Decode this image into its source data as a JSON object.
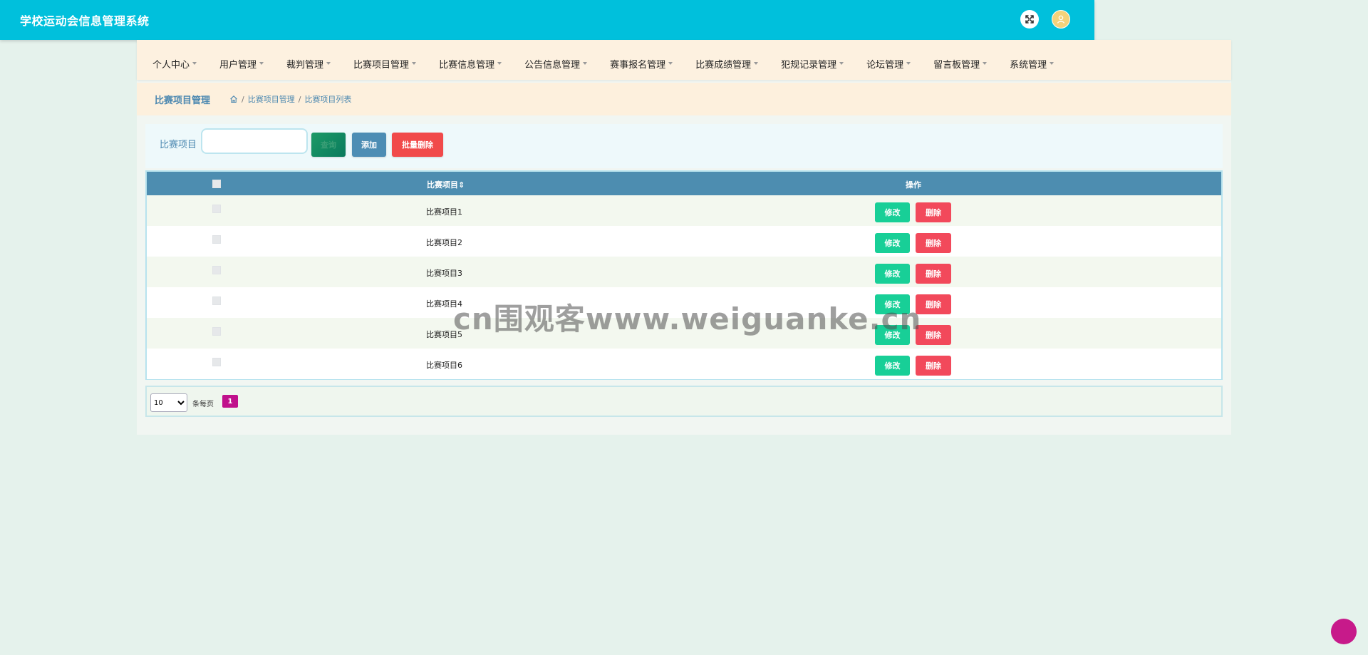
{
  "app": {
    "title": "学校运动会信息管理系统"
  },
  "header": {
    "fullscreen_icon": "fullscreen-toggle-icon",
    "avatar_icon": "user-avatar-icon"
  },
  "nav": {
    "items": [
      {
        "label": "个人中心"
      },
      {
        "label": "用户管理"
      },
      {
        "label": "裁判管理"
      },
      {
        "label": "比赛项目管理"
      },
      {
        "label": "比赛信息管理"
      },
      {
        "label": "公告信息管理"
      },
      {
        "label": "赛事报名管理"
      },
      {
        "label": "比赛成绩管理"
      },
      {
        "label": "犯规记录管理"
      },
      {
        "label": "论坛管理"
      },
      {
        "label": "留言板管理"
      },
      {
        "label": "系统管理"
      }
    ]
  },
  "breadcrumb": {
    "title": "比赛项目管理",
    "separator": "/",
    "path": [
      "比赛项目管理",
      "比赛项目列表"
    ]
  },
  "search": {
    "label": "比赛项目",
    "value": "",
    "placeholder": "",
    "query_label": "查询",
    "add_label": "添加",
    "batch_delete_label": "批量删除"
  },
  "table": {
    "headers": {
      "name": "比赛项目",
      "actions": "操作"
    },
    "rows": [
      {
        "name": "比赛项目1"
      },
      {
        "name": "比赛项目2"
      },
      {
        "name": "比赛项目3"
      },
      {
        "name": "比赛项目4"
      },
      {
        "name": "比赛项目5"
      },
      {
        "name": "比赛项目6"
      }
    ],
    "edit_label": "修改",
    "delete_label": "删除"
  },
  "pagination": {
    "page_size": "10",
    "page_size_options": [
      "10"
    ],
    "per_page_label": "条每页",
    "current_page": "1"
  },
  "watermark": "cn围观客www.weiguanke.cn"
}
